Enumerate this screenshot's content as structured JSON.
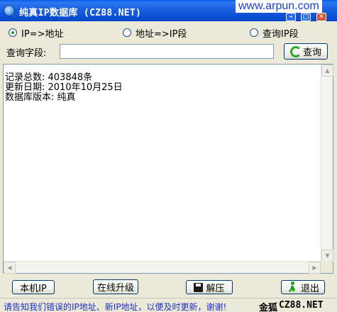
{
  "window": {
    "title": "纯真IP数据库 (CZ88.NET)",
    "watermark": "www.arpun.com"
  },
  "modes": [
    {
      "label": "IP=>地址",
      "selected": true
    },
    {
      "label": "地址=>IP段",
      "selected": false
    },
    {
      "label": "查询IP段",
      "selected": false
    }
  ],
  "query": {
    "label": "查询字段:",
    "value": "",
    "search_label": "查询"
  },
  "result": {
    "lines": [
      "记录总数: 403848条",
      "更新日期: 2010年10月25日",
      "数据库版本: 纯真"
    ]
  },
  "buttons": {
    "local_ip": "本机IP",
    "upgrade": "在线升级",
    "extract": "解压",
    "exit": "退出"
  },
  "status": {
    "message": "请告知我们错误的IP地址、新IP地址，以便及时更新，谢谢!",
    "brand": "金狐",
    "domain": "CZ88.NET"
  },
  "icons": {
    "title": "magnifier-globe-icon",
    "search": "refresh-icon",
    "extract": "disk-icon",
    "exit": "runner-icon"
  }
}
